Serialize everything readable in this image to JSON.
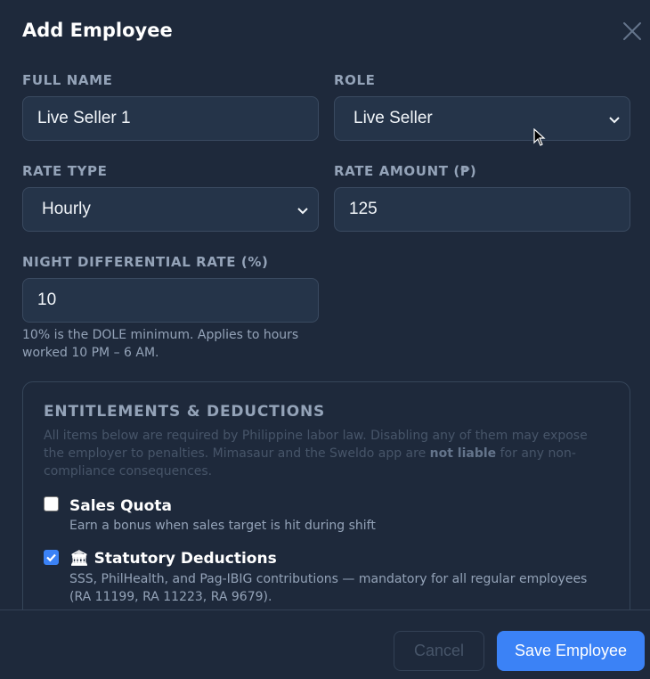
{
  "modal": {
    "title": "Add Employee"
  },
  "form": {
    "full_name": {
      "label": "FULL NAME",
      "value": "Live Seller 1"
    },
    "role": {
      "label": "ROLE",
      "value": "Live Seller"
    },
    "rate_type": {
      "label": "RATE TYPE",
      "value": "Hourly"
    },
    "rate_amount": {
      "label": "RATE AMOUNT (₱)",
      "value": "125"
    },
    "night_diff": {
      "label": "NIGHT DIFFERENTIAL RATE (%)",
      "value": "10",
      "hint": "10% is the DOLE minimum. Applies to hours worked 10 PM – 6 AM."
    }
  },
  "entitlements": {
    "title": "ENTITLEMENTS & DEDUCTIONS",
    "desc_before": "All items below are required by Philippine labor law. Disabling any of them may expose the employer to penalties. Mimasaur and the Sweldo app are ",
    "desc_bold": "not liable",
    "desc_after": " for any non-compliance consequences.",
    "items": [
      {
        "title": "Sales Quota",
        "desc": "Earn a bonus when sales target is hit during shift",
        "checked": false,
        "icon": ""
      },
      {
        "title": "Statutory Deductions",
        "desc": "SSS, PhilHealth, and Pag-IBIG contributions — mandatory for all regular employees (RA 11199, RA 11223, RA 9679).",
        "checked": true,
        "icon": "🏛"
      }
    ]
  },
  "footer": {
    "cancel_label": "Cancel",
    "save_label": "Save Employee"
  },
  "colors": {
    "background": "#1e293b",
    "accent": "#3b82f6",
    "field": "#253449"
  }
}
